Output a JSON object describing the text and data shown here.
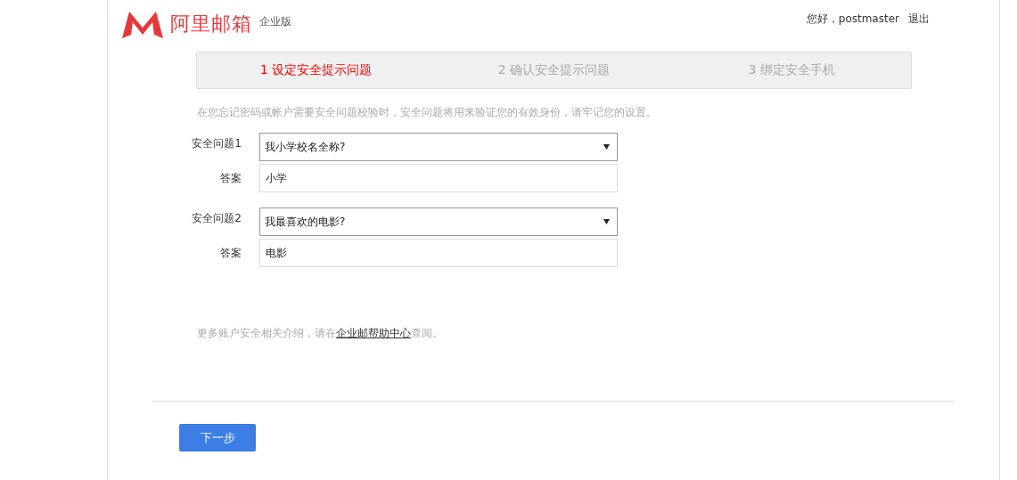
{
  "header": {
    "brand": "阿里邮箱",
    "edition": "企业版",
    "greeting": "您好，postmaster",
    "logout": "退出"
  },
  "steps": [
    {
      "label": "1 设定安全提示问题",
      "selected": true
    },
    {
      "label": "2 确认安全提示问题",
      "selected": false
    },
    {
      "label": "3 绑定安全手机",
      "selected": false
    }
  ],
  "intro": "在您忘记密码或帐户需要安全问题校验时，安全问题将用来验证您的有效身份，请牢记您的设置。",
  "questions": [
    {
      "label": "安全问题1",
      "question": "我小学校名全称?",
      "answer_label": "答案",
      "answer": "小学"
    },
    {
      "label": "安全问题2",
      "question": "我最喜欢的电影?",
      "answer_label": "答案",
      "answer": "电影"
    }
  ],
  "help_note": {
    "before": "更多账户安全相关介绍，请在",
    "link": "企业邮帮助中心",
    "after": "查阅。"
  },
  "next_button": "下一步"
}
